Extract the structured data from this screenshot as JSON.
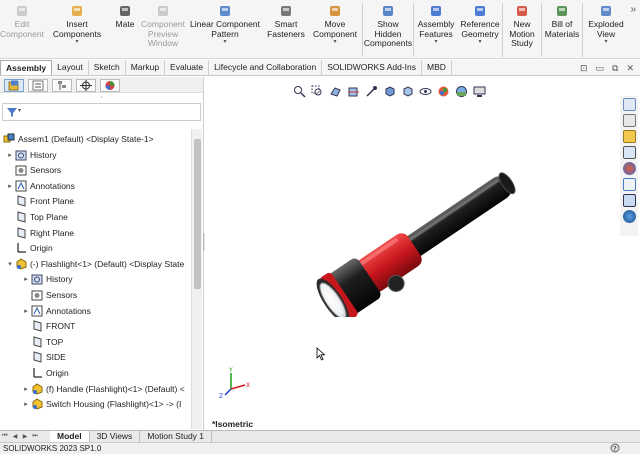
{
  "ribbon": {
    "buttons": [
      {
        "label": "Edit\nComponent",
        "disabled": true,
        "icon": "edit-component-icon"
      },
      {
        "label": "Insert\nComponents",
        "disabled": false,
        "caret": true,
        "icon": "insert-components-icon"
      },
      {
        "label": "Mate",
        "disabled": false,
        "icon": "mate-icon"
      },
      {
        "label": "Component\nPreview\nWindow",
        "disabled": true,
        "icon": "component-preview-icon"
      },
      {
        "label": "Linear Component\nPattern",
        "disabled": false,
        "caret": true,
        "icon": "linear-pattern-icon"
      },
      {
        "label": "Smart\nFasteners",
        "disabled": false,
        "icon": "smart-fasteners-icon"
      },
      {
        "label": "Move\nComponent",
        "disabled": false,
        "caret": true,
        "icon": "move-component-icon"
      },
      {
        "label": "Show\nHidden\nComponents",
        "disabled": false,
        "icon": "show-hidden-icon"
      },
      {
        "label": "Assembly\nFeatures",
        "disabled": false,
        "caret": true,
        "icon": "assembly-features-icon"
      },
      {
        "label": "Reference\nGeometry",
        "disabled": false,
        "caret": true,
        "icon": "reference-geometry-icon"
      },
      {
        "label": "New\nMotion\nStudy",
        "disabled": false,
        "icon": "motion-study-icon"
      },
      {
        "label": "Bill of\nMaterials",
        "disabled": false,
        "icon": "bom-icon"
      },
      {
        "label": "Exploded\nView",
        "disabled": false,
        "caret": true,
        "icon": "exploded-view-icon"
      }
    ]
  },
  "tabs": [
    "Assembly",
    "Layout",
    "Sketch",
    "Markup",
    "Evaluate",
    "Lifecycle and Collaboration",
    "SOLIDWORKS Add-Ins",
    "MBD"
  ],
  "active_tab": "Assembly",
  "tree": {
    "root": "Assem1 (Default) <Display State-1>",
    "items": [
      {
        "label": "History",
        "icon": "history-icon",
        "expander": "▸"
      },
      {
        "label": "Sensors",
        "icon": "sensors-icon",
        "expander": ""
      },
      {
        "label": "Annotations",
        "icon": "annotations-icon",
        "expander": "▸"
      },
      {
        "label": "Front Plane",
        "icon": "plane-icon",
        "expander": ""
      },
      {
        "label": "Top Plane",
        "icon": "plane-icon",
        "expander": ""
      },
      {
        "label": "Right Plane",
        "icon": "plane-icon",
        "expander": ""
      },
      {
        "label": "Origin",
        "icon": "origin-icon",
        "expander": ""
      },
      {
        "label": "(-) Flashlight<1> (Default) <Display State",
        "icon": "part-icon",
        "expander": "▾"
      },
      {
        "label": "History",
        "icon": "history-icon",
        "expander": "▸"
      },
      {
        "label": "Sensors",
        "icon": "sensors-icon",
        "expander": ""
      },
      {
        "label": "Annotations",
        "icon": "annotations-icon",
        "expander": "▸"
      },
      {
        "label": "FRONT",
        "icon": "plane-icon",
        "expander": ""
      },
      {
        "label": "TOP",
        "icon": "plane-icon",
        "expander": ""
      },
      {
        "label": "SIDE",
        "icon": "plane-icon",
        "expander": ""
      },
      {
        "label": "Origin",
        "icon": "origin-icon",
        "expander": ""
      },
      {
        "label": "(f) Handle (Flashlight)<1> (Default) <",
        "icon": "part-icon",
        "expander": "▸"
      },
      {
        "label": "Switch Housing (Flashlight)<1> -> (I",
        "icon": "part-icon",
        "expander": "▸"
      }
    ]
  },
  "viewport": {
    "orientation": "*Isometric"
  },
  "bottom_tabs": [
    "Model",
    "3D Views",
    "Motion Study 1"
  ],
  "active_bottom_tab": "Model",
  "status": "SOLIDWORKS 2023 SP1.0",
  "colors": {
    "accent_red": "#c8161d",
    "body_dark": "#1a1a1a",
    "ribbon_bg": "#f5f5f5"
  }
}
